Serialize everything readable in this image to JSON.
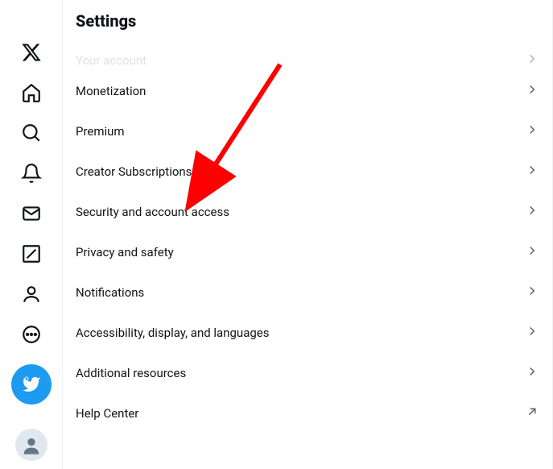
{
  "header": {
    "title": "Settings"
  },
  "faded": {
    "label": "Your account"
  },
  "settings_items": [
    {
      "label": "Monetization",
      "icon": "chevron-right"
    },
    {
      "label": "Premium",
      "icon": "chevron-right"
    },
    {
      "label": "Creator Subscriptions",
      "icon": "chevron-right"
    },
    {
      "label": "Security and account access",
      "icon": "chevron-right"
    },
    {
      "label": "Privacy and safety",
      "icon": "chevron-right"
    },
    {
      "label": "Notifications",
      "icon": "chevron-right"
    },
    {
      "label": "Accessibility, display, and languages",
      "icon": "chevron-right"
    },
    {
      "label": "Additional resources",
      "icon": "chevron-right"
    },
    {
      "label": "Help Center",
      "icon": "external-link"
    }
  ],
  "nav": {
    "items": [
      "logo",
      "home",
      "search",
      "notifications",
      "messages",
      "grok",
      "profile",
      "more"
    ]
  },
  "annotation": {
    "type": "arrow",
    "color": "#ff0000",
    "points_to": "Security and account access"
  }
}
